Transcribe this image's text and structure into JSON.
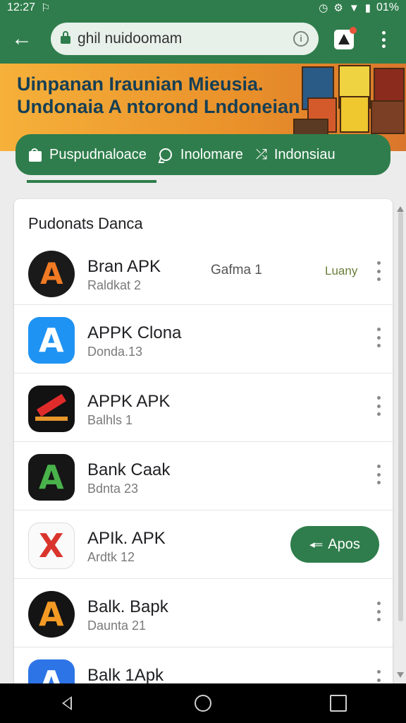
{
  "status_bar": {
    "time": "12:27",
    "left_icon": "app-notification-icon",
    "battery": "01%",
    "right_icons": [
      "alarm-icon",
      "settings-icon",
      "wifi-icon",
      "battery-icon"
    ]
  },
  "browser": {
    "url": "ghil nuidoomam",
    "back_icon": "arrow-left-icon",
    "lock_icon": "lock-icon",
    "info_icon": "info-icon",
    "tabs_icon": "tabs-icon",
    "menu_icon": "more-vert-icon"
  },
  "banner": {
    "line1": "Uinpanan Iraunian Mieusia.",
    "line2": "Undonaia A ntorond Lndoneian"
  },
  "tabs": [
    {
      "label": "Puspudnaloace",
      "icon": "shopping-bag-icon"
    },
    {
      "label": "Inolomare",
      "icon": "chat-bubble-icon"
    },
    {
      "label": "Indonsiau",
      "icon": "x-cross-icon"
    }
  ],
  "list": {
    "title": "Pudonats Danca",
    "items": [
      {
        "name": "Bran APK",
        "subtitle": "Raldkat 2",
        "extra": "Gafma 1",
        "status": "Luany",
        "icon": "app-a-orange-icon",
        "has_button": false
      },
      {
        "name": "APPK Clona",
        "subtitle": "Donda.13",
        "icon": "app-a-blue-icon",
        "has_button": false
      },
      {
        "name": "APPK APK",
        "subtitle": "Balhls 1",
        "icon": "app-red-arrow-icon",
        "has_button": false
      },
      {
        "name": "Bank Caak",
        "subtitle": "Bdnta 23",
        "icon": "app-a-green-icon",
        "has_button": false
      },
      {
        "name": "APIk. APK",
        "subtitle": "Ardtk 12",
        "icon": "app-x-red-icon",
        "has_button": true,
        "button_label": "Apos"
      },
      {
        "name": "Balk. Bapk",
        "subtitle": "Daunta 21",
        "icon": "app-a-multicolor-icon",
        "has_button": false
      },
      {
        "name": "Balk 1Apk",
        "subtitle": "",
        "icon": "app-a-blue-white-icon",
        "has_button": false
      }
    ]
  },
  "colors": {
    "primary": "#2f7d4c",
    "banner_start": "#f6b13a",
    "banner_end": "#d9762c",
    "text": "#202124"
  },
  "nav_bar": {
    "buttons": [
      "back-triangle-icon",
      "home-circle-icon",
      "recents-square-icon"
    ]
  }
}
